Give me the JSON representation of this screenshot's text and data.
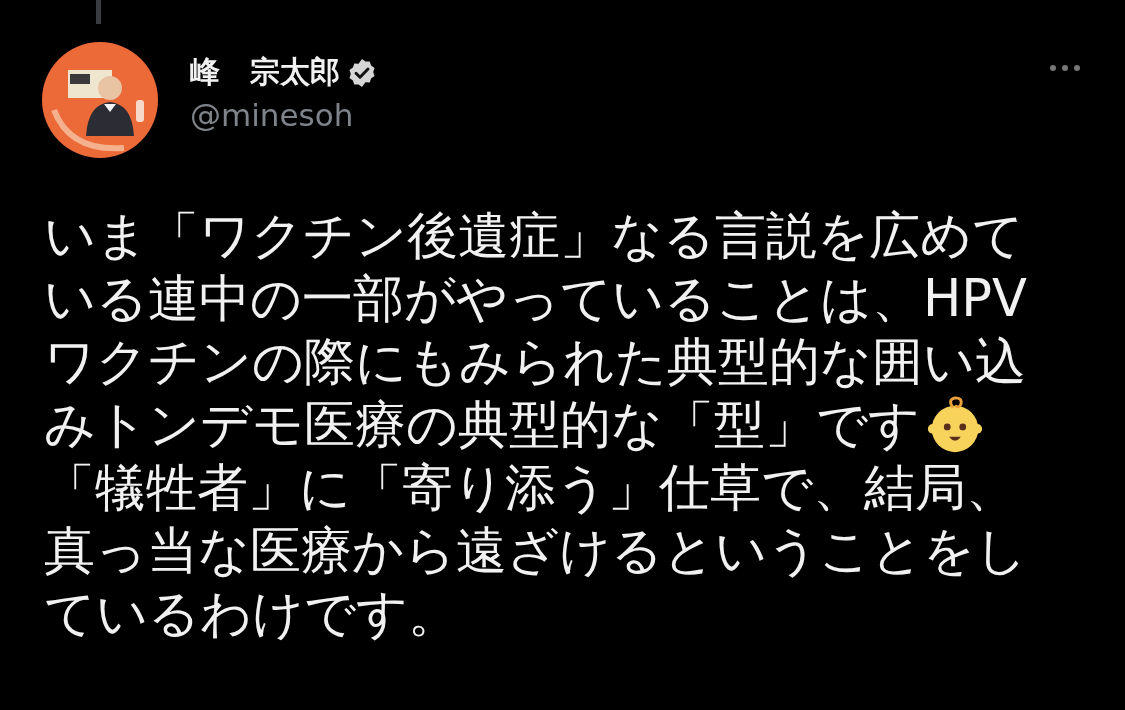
{
  "author": {
    "name": "峰　宗太郎",
    "handle": "@minesoh",
    "verified": true
  },
  "body": [
    "いま「ワクチン後遺症」なる言説を広めている連中の一部がやっていることは、HPVワクチンの際にもみられた典型的な囲い込",
    "みトンデモ医療の典型的な「型」です",
    "「犠牲者」に「寄り添う」仕草で、結局、真っ当な医療から遠ざけるということをしているわけです。"
  ]
}
